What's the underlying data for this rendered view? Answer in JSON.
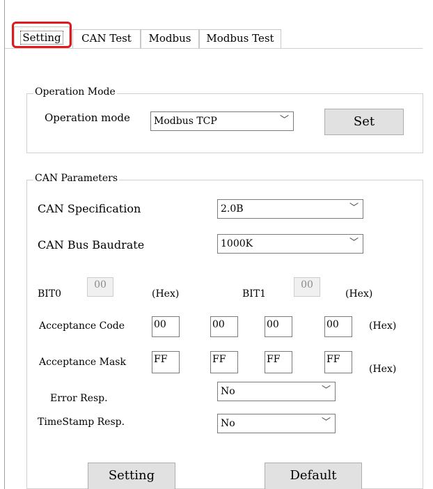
{
  "tabs": [
    {
      "label": "Setting"
    },
    {
      "label": "CAN Test"
    },
    {
      "label": "Modbus"
    },
    {
      "label": "Modbus Test"
    }
  ],
  "operation_mode": {
    "group_title": "Operation Mode",
    "label": "Operation mode",
    "value": "Modbus TCP",
    "set_button": "Set"
  },
  "can_parameters": {
    "group_title": "CAN Parameters",
    "spec_label": "CAN Specification",
    "spec_value": "2.0B",
    "baud_label": "CAN Bus Baudrate",
    "baud_value": "1000K",
    "bit0_label": "BIT0",
    "bit0_value": "00",
    "bit1_label": "BIT1",
    "bit1_value": "00",
    "hex_unit": "(Hex)",
    "acceptance_code_label": "Acceptance Code",
    "acceptance_code": [
      "00",
      "00",
      "00",
      "00"
    ],
    "acceptance_mask_label": "Acceptance Mask",
    "acceptance_mask": [
      "FF",
      "FF",
      "FF",
      "FF"
    ],
    "error_resp_label": "Error Resp.",
    "error_resp_value": "No",
    "timestamp_resp_label": "TimeStamp Resp.",
    "timestamp_resp_value": "No",
    "setting_button": "Setting",
    "default_button": "Default"
  },
  "colors": {
    "highlight": "#e0191e",
    "button_bg": "#e1e1e1",
    "border": "#d0d0d0"
  }
}
